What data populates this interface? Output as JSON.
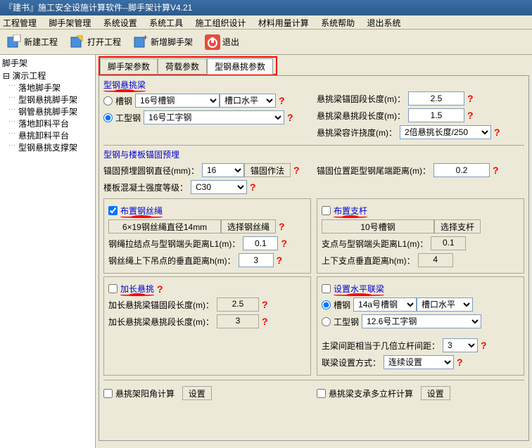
{
  "title": "『建书』施工安全设施计算软件--脚手架计算V4.21",
  "menu": [
    "工程管理",
    "脚手架管理",
    "系统设置",
    "系统工具",
    "施工组织设计",
    "材料用量计算",
    "系统帮助",
    "退出系统"
  ],
  "toolbar": {
    "new": "新建工程",
    "open": "打开工程",
    "add": "新增脚手架",
    "exit": "退出"
  },
  "tree": {
    "title": "脚手架",
    "root": "演示工程",
    "items": [
      "落地脚手架",
      "型钢悬挑脚手架",
      "钢管悬挑脚手架",
      "落地卸料平台",
      "悬挑卸料平台",
      "型钢悬挑支撑架"
    ]
  },
  "tabs": [
    "脚手架参数",
    "荷载参数",
    "型钢悬挑参数"
  ],
  "g1": {
    "title": "型钢悬挑梁",
    "r_channel": "槽钢",
    "r_ibeam": "工型钢",
    "channel_val": "16号槽钢",
    "orient": "槽口水平［",
    "ibeam_val": "16号工字钢",
    "anchor_len": "悬挑梁锚固段长度(m)：",
    "anchor_len_v": "2.5",
    "cant_len": "悬挑梁悬挑段长度(m)：",
    "cant_len_v": "1.5",
    "defl": "悬挑梁容许挠度(m)：",
    "defl_v": "2倍悬挑长度/250"
  },
  "g2": {
    "title": "型钢与楼板锚固预埋",
    "dia": "锚固预埋圆钢直径(mm)：",
    "dia_v": "16",
    "method": "锚固作法",
    "pos": "锚固位置距型钢尾端距离(m)：",
    "pos_v": "0.2",
    "grade": "楼板混凝土强度等级：",
    "grade_v": "C30"
  },
  "g3": {
    "chk": "布置钢丝绳",
    "spec": "6×19钢丝绳直径14mm",
    "sel": "选择钢丝绳",
    "l1": "钢绳拉结点与型钢端头距离L1(m)：",
    "l1_v": "0.1",
    "h": "钢丝绳上下吊点的垂直距离h(m)：",
    "h_v": "3"
  },
  "g4": {
    "chk": "布置支杆",
    "spec": "10号槽钢",
    "sel": "选择支杆",
    "l1": "支点与型钢端头距离L1(m)：",
    "l1_v": "0.1",
    "h": "上下支点垂直距离h(m)：",
    "h_v": "4"
  },
  "g5": {
    "chk": "加长悬挑",
    "a": "加长悬挑梁锚固段长度(m)：",
    "a_v": "2.5",
    "b": "加长悬挑梁悬挑段长度(m)：",
    "b_v": "3"
  },
  "g6": {
    "chk": "设置水平联梁",
    "r1": "槽钢",
    "r1_v": "14a号槽钢",
    "r1_o": "槽口水平［",
    "r2": "工型钢",
    "r2_v": "12.6号工字钢",
    "span": "主梁间距相当于几倍立杆间距：",
    "span_v": "3",
    "mode": "联梁设置方式：",
    "mode_v": "连续设置"
  },
  "bottom": {
    "chk1": "悬挑架阳角计算",
    "btn1": "设置",
    "chk2": "悬挑梁支承多立杆计算",
    "btn2": "设置"
  },
  "help": "?"
}
